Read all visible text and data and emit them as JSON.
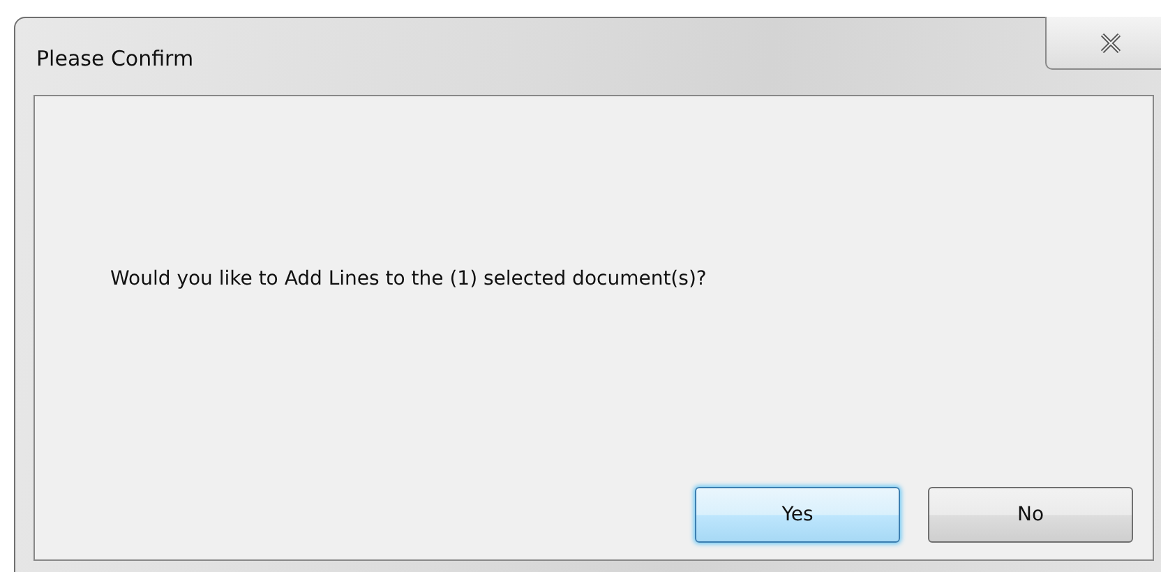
{
  "window": {
    "title": "Please Confirm"
  },
  "message": "Would you like to Add Lines to the (1) selected document(s)?",
  "buttons": [
    {
      "label": "Yes",
      "default": true
    },
    {
      "label": "No",
      "default": false
    }
  ]
}
